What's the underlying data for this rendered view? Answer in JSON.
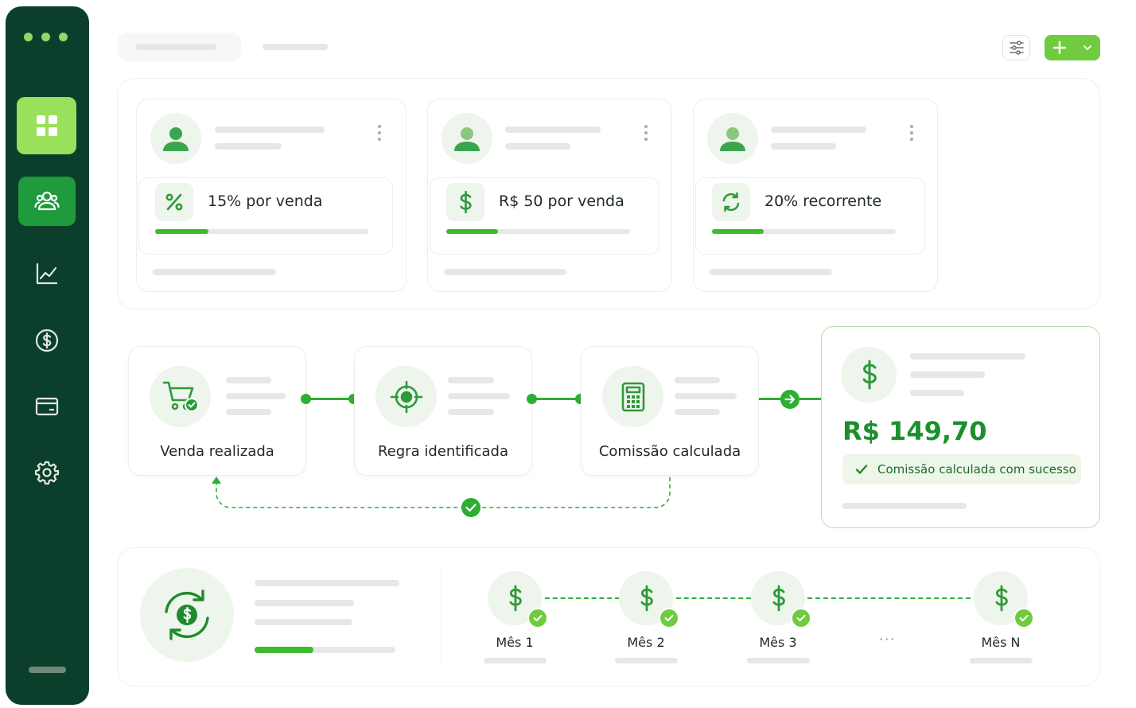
{
  "sidebar": {
    "items": [
      {
        "name": "dashboard",
        "icon": "grid-icon"
      },
      {
        "name": "affiliates",
        "icon": "users-icon"
      },
      {
        "name": "reports",
        "icon": "line-chart-icon"
      },
      {
        "name": "payments",
        "icon": "dollar-circle-icon"
      },
      {
        "name": "wallet",
        "icon": "card-icon"
      },
      {
        "name": "settings",
        "icon": "gear-icon"
      }
    ]
  },
  "header": {
    "filter_icon": "sliders-icon",
    "add_icon": "plus-icon",
    "add_dropdown_icon": "chevron-down-icon"
  },
  "rules": [
    {
      "label": "15% por venda",
      "icon": "percent-icon",
      "progress": 0.25
    },
    {
      "label": "R$ 50 por venda",
      "icon": "dollar-icon",
      "progress": 0.28
    },
    {
      "label": "20% recorrente",
      "icon": "refresh-icon",
      "progress": 0.28
    }
  ],
  "flow": {
    "steps": [
      {
        "label": "Venda realizada",
        "icon": "cart-check-icon"
      },
      {
        "label": "Regra identificada",
        "icon": "target-icon"
      },
      {
        "label": "Comissão calculada",
        "icon": "calculator-icon"
      }
    ],
    "result": {
      "value": "R$ 149,70",
      "status": "Comissão calculada com sucesso"
    }
  },
  "recurring": {
    "progress": 0.42,
    "months": [
      "Mês 1",
      "Mês 2",
      "Mês 3",
      "Mês N"
    ],
    "ellipsis": "···"
  },
  "colors": {
    "sidebar": "#0c3f2b",
    "accent": "#2eae33",
    "accent_light": "#9be05b",
    "value": "#1c8f2c"
  }
}
